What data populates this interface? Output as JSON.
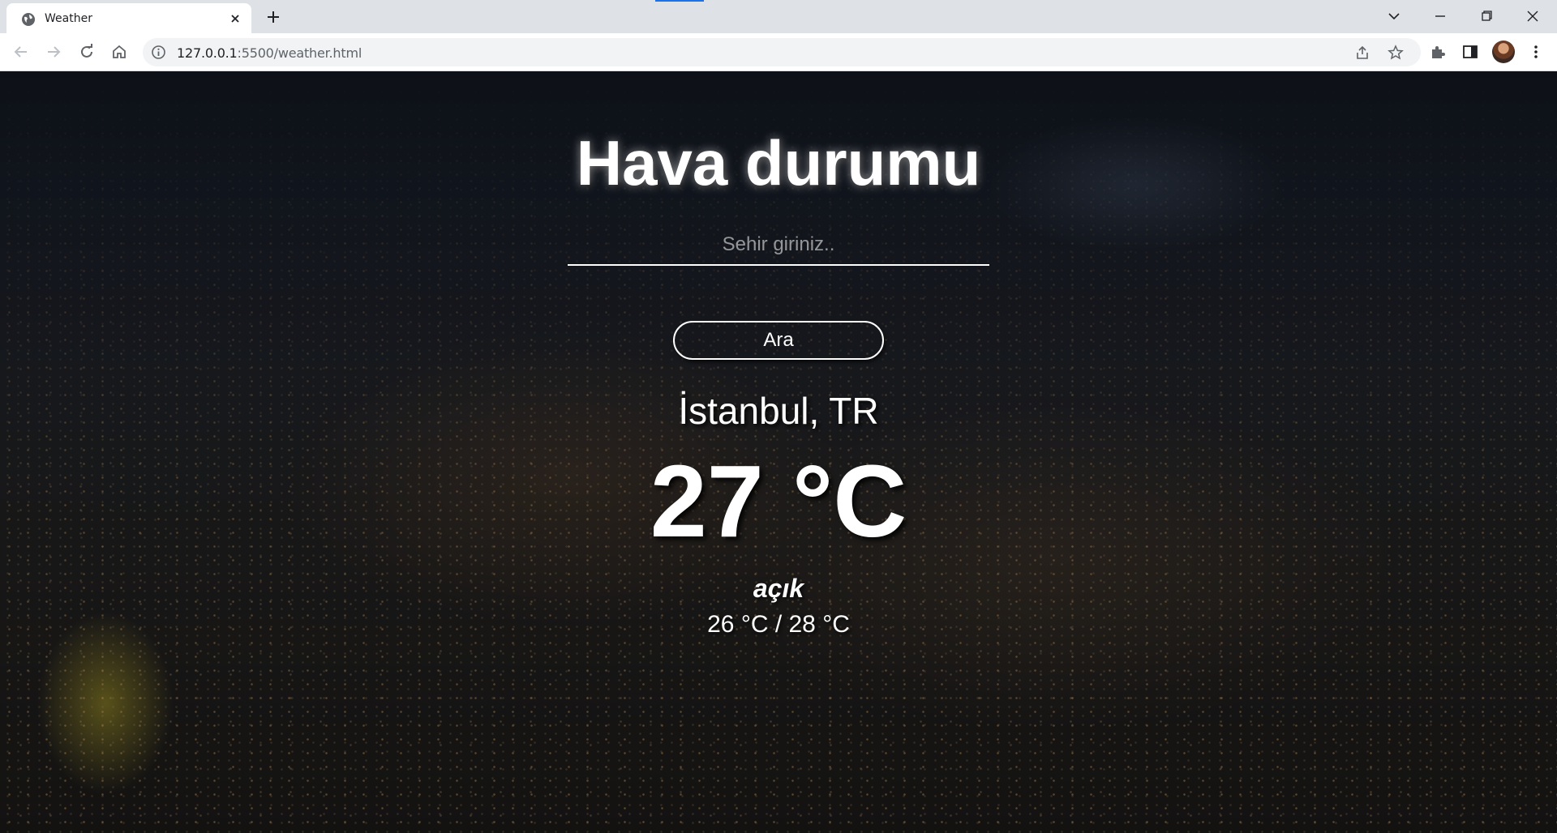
{
  "browser": {
    "tab_title": "Weather",
    "url_host": "127.0.0.1",
    "url_rest": ":5500/weather.html"
  },
  "page": {
    "title": "Hava durumu",
    "search_placeholder": "Sehir giriniz..",
    "search_button": "Ara",
    "city": "İstanbul, TR",
    "temperature": "27 °C",
    "description": "açık",
    "min_max": "26 °C / 28 °C"
  },
  "icons": {
    "favicon": "globe-icon",
    "tab_close": "close-icon",
    "new_tab": "plus-icon",
    "back": "back-arrow-icon",
    "forward": "forward-arrow-icon",
    "reload": "reload-icon",
    "home": "home-icon",
    "site_info": "info-icon",
    "share": "share-icon",
    "bookmark": "star-icon",
    "extensions": "puzzle-icon",
    "side_panel": "side-panel-icon",
    "menu": "kebab-menu-icon"
  },
  "colors": {
    "tabstrip": "#dee1e6",
    "toolbar": "#ffffff",
    "omnibox": "#f1f3f4",
    "page_text": "#ffffff"
  }
}
